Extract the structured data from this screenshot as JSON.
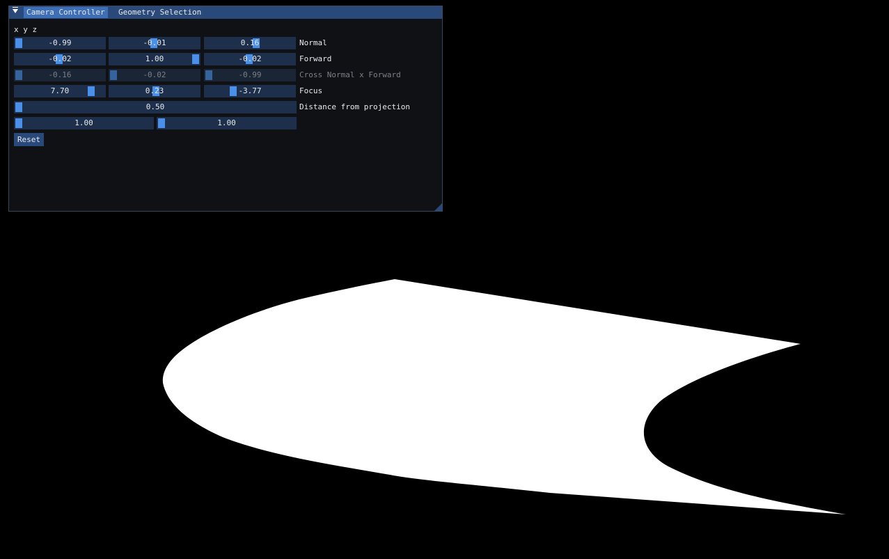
{
  "window": {
    "tabs": [
      {
        "label": "Camera Controller",
        "active": true
      },
      {
        "label": "Geometry Selection",
        "active": false
      }
    ],
    "columns_header": "x y z"
  },
  "rows": [
    {
      "label": "Normal",
      "disabled": false,
      "sliders": [
        {
          "value": "-0.99",
          "fraction": 0.0
        },
        {
          "value": "-0.01",
          "fraction": 0.49
        },
        {
          "value": "0.16",
          "fraction": 0.58
        }
      ]
    },
    {
      "label": "Forward",
      "disabled": false,
      "sliders": [
        {
          "value": "-0.02",
          "fraction": 0.49
        },
        {
          "value": "1.00",
          "fraction": 1.0
        },
        {
          "value": "-0.02",
          "fraction": 0.49
        }
      ]
    },
    {
      "label": "Cross Normal x Forward",
      "disabled": true,
      "sliders": [
        {
          "value": "-0.16",
          "fraction": 0.0
        },
        {
          "value": "-0.02",
          "fraction": 0.0
        },
        {
          "value": "-0.99",
          "fraction": 0.0
        }
      ]
    },
    {
      "label": "Focus",
      "disabled": false,
      "sliders": [
        {
          "value": "7.70",
          "fraction": 0.88
        },
        {
          "value": "0.23",
          "fraction": 0.52
        },
        {
          "value": "-3.77",
          "fraction": 0.3
        }
      ]
    }
  ],
  "distance": {
    "label": "Distance from projection",
    "value": "0.50",
    "fraction": 0.0
  },
  "scale": [
    {
      "value": "1.00",
      "fraction": 0.0
    },
    {
      "value": "1.00",
      "fraction": 0.0
    }
  ],
  "reset_label": "Reset",
  "colors": {
    "background": "#000000",
    "surface": "#ffffff",
    "title_bar": "#29497a",
    "active_tab": "#3e6eb5",
    "slider_frame": "#1d2f4a",
    "slider_grab": "#4a90e8"
  },
  "icons": {
    "collapse": "triangle-down-icon",
    "resize": "resize-grip-icon"
  }
}
